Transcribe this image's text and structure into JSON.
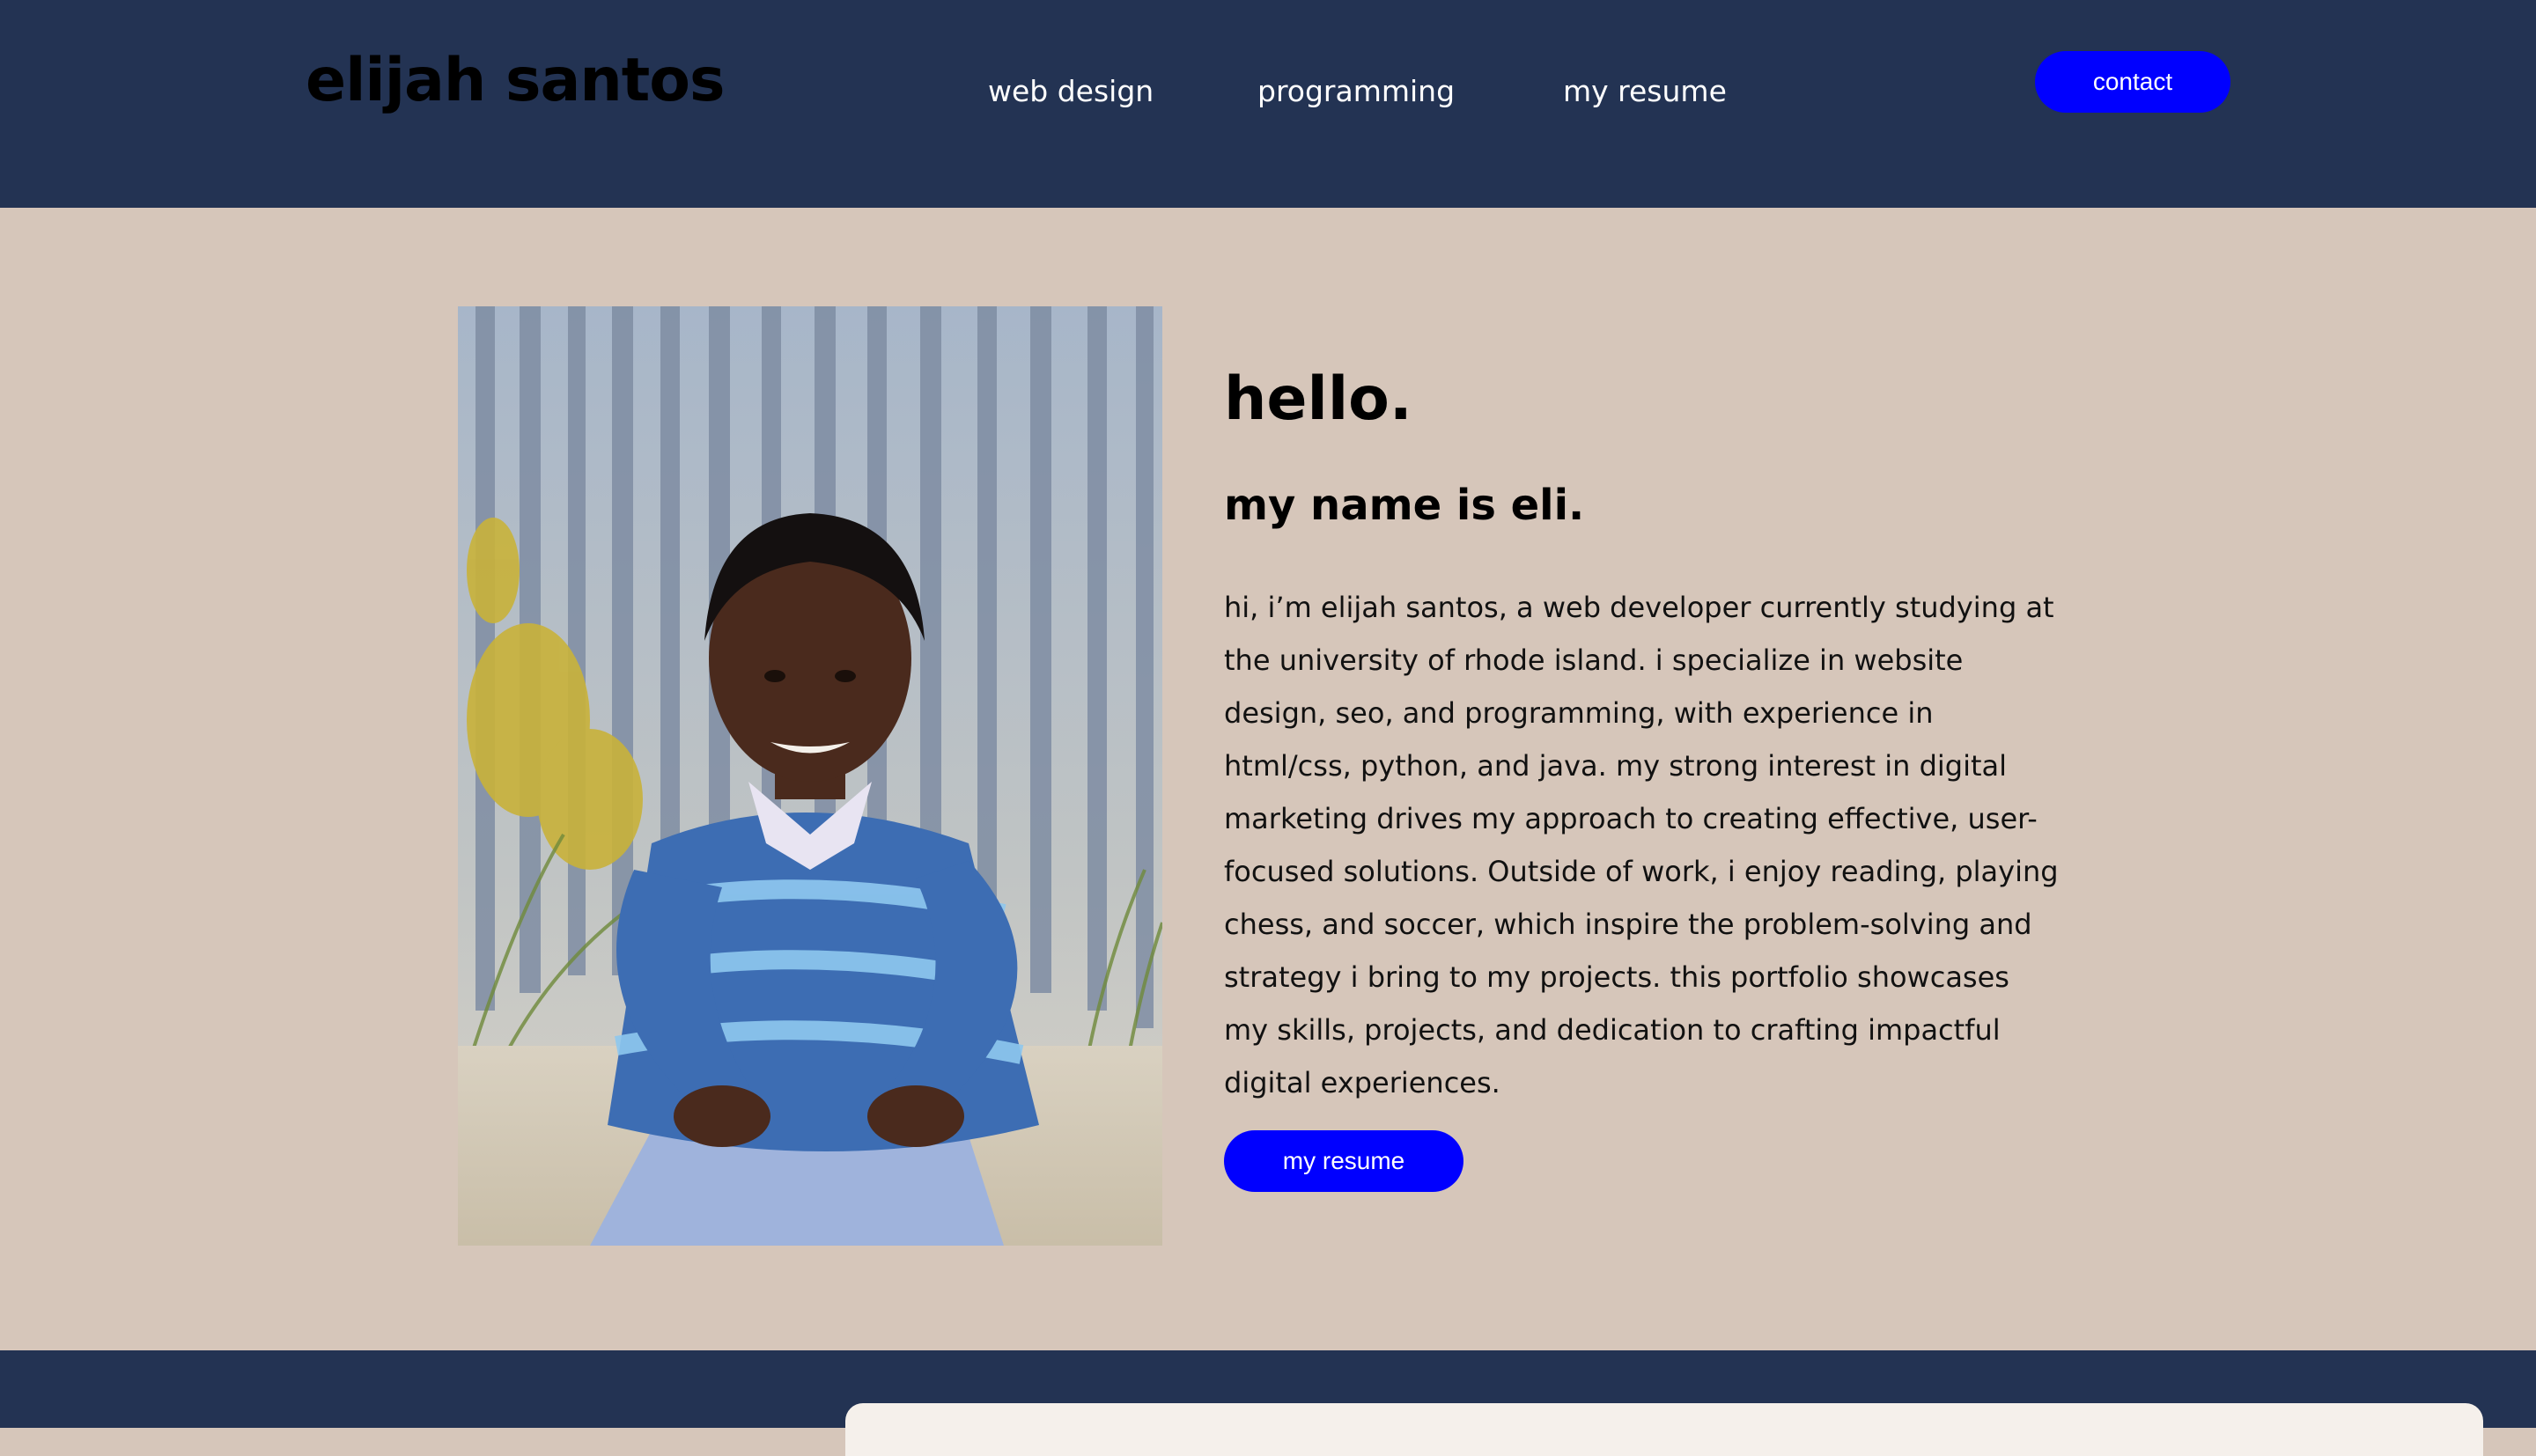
{
  "header": {
    "site_title": "elijah santos",
    "nav": [
      {
        "label": "web design"
      },
      {
        "label": "programming"
      },
      {
        "label": "my resume"
      }
    ],
    "contact_label": "contact"
  },
  "main": {
    "photo_alt": "elijah santos",
    "greeting": "hello.",
    "subtitle": "my name is eli.",
    "bio": "hi, i’m elijah santos, a web developer currently studying at the university of rhode island. i specialize in website design, seo, and programming, with experience in html/css, python, and java. my strong interest in digital marketing drives my approach to creating effective, user-focused solutions. Outside of work, i enjoy reading, playing chess, and soccer, which inspire the problem-solving and strategy i bring to my projects. this portfolio showcases my skills, projects, and dedication to crafting impactful digital experiences.",
    "resume_button_label": "my resume"
  },
  "colors": {
    "header_bg": "#233353",
    "main_bg": "#d6c6ba",
    "accent": "#0000ff",
    "text": "#000000"
  }
}
